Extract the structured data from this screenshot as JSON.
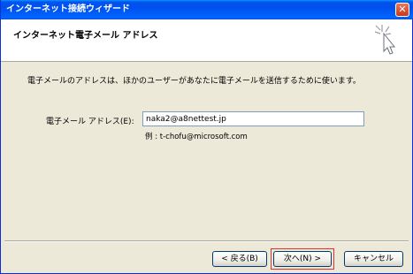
{
  "window": {
    "title": "インターネット接続ウィザード",
    "close_label": "✕"
  },
  "header": {
    "title": "インターネット電子メール アドレス",
    "icon": "sparkle-cursor-icon"
  },
  "body": {
    "description": "電子メールのアドレスは、ほかのユーザーがあなたに電子メールを送信するために使います。",
    "email_label": "電子メール アドレス(E):",
    "email_value": "naka2@a8nettest.jp",
    "example": "例 : t-chofu@microsoft.com"
  },
  "buttons": {
    "back": "< 戻る(B)",
    "next": "次へ(N) >",
    "cancel": "キャンセル"
  },
  "colors": {
    "titlebar": "#0054e3",
    "dialog_bg": "#ece9d8",
    "focus_outline": "#e03030"
  }
}
